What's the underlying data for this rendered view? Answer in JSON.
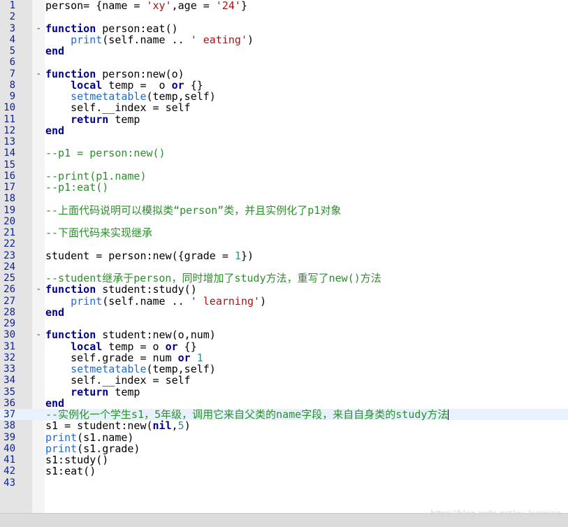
{
  "editor": {
    "colors": {
      "keyword": "#00008b",
      "string": "#a31515",
      "number": "#2f8f8f",
      "builtin": "#1a6bd8",
      "comment": "#2a8f2a",
      "line_number": "#10209a"
    },
    "current_line": 37,
    "lines": [
      {
        "n": "1",
        "fold": false,
        "tokens": [
          [
            "t",
            "person= {name = "
          ],
          [
            "s",
            "'xy'"
          ],
          [
            "t",
            ",age = "
          ],
          [
            "s",
            "'24'"
          ],
          [
            "t",
            "}"
          ]
        ]
      },
      {
        "n": "2",
        "fold": false,
        "tokens": []
      },
      {
        "n": "3",
        "fold": true,
        "tokens": [
          [
            "k",
            "function"
          ],
          [
            "t",
            " person:eat()"
          ]
        ]
      },
      {
        "n": "4",
        "fold": false,
        "tokens": [
          [
            "t",
            "    "
          ],
          [
            "f",
            "print"
          ],
          [
            "t",
            "(self.name .. "
          ],
          [
            "s",
            "' eating'"
          ],
          [
            "t",
            ")"
          ]
        ]
      },
      {
        "n": "5",
        "fold": false,
        "tokens": [
          [
            "k",
            "end"
          ]
        ]
      },
      {
        "n": "6",
        "fold": false,
        "tokens": []
      },
      {
        "n": "7",
        "fold": true,
        "tokens": [
          [
            "k",
            "function"
          ],
          [
            "t",
            " person:new(o)"
          ]
        ]
      },
      {
        "n": "8",
        "fold": false,
        "tokens": [
          [
            "t",
            "    "
          ],
          [
            "k",
            "local"
          ],
          [
            "t",
            " temp =  o "
          ],
          [
            "k",
            "or"
          ],
          [
            "t",
            " {}"
          ]
        ]
      },
      {
        "n": "9",
        "fold": false,
        "tokens": [
          [
            "t",
            "    "
          ],
          [
            "f",
            "setmetatable"
          ],
          [
            "t",
            "(temp,self)"
          ]
        ]
      },
      {
        "n": "10",
        "fold": false,
        "tokens": [
          [
            "t",
            "    self.__index = self"
          ]
        ]
      },
      {
        "n": "11",
        "fold": false,
        "tokens": [
          [
            "t",
            "    "
          ],
          [
            "k",
            "return"
          ],
          [
            "t",
            " temp"
          ]
        ]
      },
      {
        "n": "12",
        "fold": false,
        "tokens": [
          [
            "k",
            "end"
          ]
        ]
      },
      {
        "n": "13",
        "fold": false,
        "tokens": []
      },
      {
        "n": "14",
        "fold": false,
        "tokens": [
          [
            "c",
            "--p1 = person:new()"
          ]
        ]
      },
      {
        "n": "15",
        "fold": false,
        "tokens": []
      },
      {
        "n": "16",
        "fold": false,
        "tokens": [
          [
            "c",
            "--print(p1.name)"
          ]
        ]
      },
      {
        "n": "17",
        "fold": false,
        "tokens": [
          [
            "c",
            "--p1:eat()"
          ]
        ]
      },
      {
        "n": "18",
        "fold": false,
        "tokens": []
      },
      {
        "n": "19",
        "fold": false,
        "tokens": [
          [
            "c",
            "--上面代码说明可以模拟类“person”类，并且实例化了p1对象"
          ]
        ]
      },
      {
        "n": "20",
        "fold": false,
        "tokens": []
      },
      {
        "n": "21",
        "fold": false,
        "tokens": [
          [
            "c",
            "--下面代码来实现继承"
          ]
        ]
      },
      {
        "n": "22",
        "fold": false,
        "tokens": []
      },
      {
        "n": "23",
        "fold": false,
        "tokens": [
          [
            "t",
            "student = person:new({grade = "
          ],
          [
            "n",
            "1"
          ],
          [
            "t",
            "})"
          ]
        ]
      },
      {
        "n": "24",
        "fold": false,
        "tokens": []
      },
      {
        "n": "25",
        "fold": false,
        "tokens": [
          [
            "c",
            "--student继承于person，同时增加了study方法，重写了new()方法"
          ]
        ]
      },
      {
        "n": "26",
        "fold": true,
        "tokens": [
          [
            "k",
            "function"
          ],
          [
            "t",
            " student:study()"
          ]
        ]
      },
      {
        "n": "27",
        "fold": false,
        "tokens": [
          [
            "t",
            "    "
          ],
          [
            "f",
            "print"
          ],
          [
            "t",
            "(self.name .. "
          ],
          [
            "s",
            "' learning'"
          ],
          [
            "t",
            ")"
          ]
        ]
      },
      {
        "n": "28",
        "fold": false,
        "tokens": [
          [
            "k",
            "end"
          ]
        ]
      },
      {
        "n": "29",
        "fold": false,
        "tokens": []
      },
      {
        "n": "30",
        "fold": true,
        "tokens": [
          [
            "k",
            "function"
          ],
          [
            "t",
            " student:new(o,num)"
          ]
        ]
      },
      {
        "n": "31",
        "fold": false,
        "tokens": [
          [
            "t",
            "    "
          ],
          [
            "k",
            "local"
          ],
          [
            "t",
            " temp = o "
          ],
          [
            "k",
            "or"
          ],
          [
            "t",
            " {}"
          ]
        ]
      },
      {
        "n": "32",
        "fold": false,
        "tokens": [
          [
            "t",
            "    self.grade = num "
          ],
          [
            "k",
            "or"
          ],
          [
            "t",
            " "
          ],
          [
            "n",
            "1"
          ]
        ]
      },
      {
        "n": "33",
        "fold": false,
        "tokens": [
          [
            "t",
            "    "
          ],
          [
            "f",
            "setmetatable"
          ],
          [
            "t",
            "(temp,self)"
          ]
        ]
      },
      {
        "n": "34",
        "fold": false,
        "tokens": [
          [
            "t",
            "    self.__index = self"
          ]
        ]
      },
      {
        "n": "35",
        "fold": false,
        "tokens": [
          [
            "t",
            "    "
          ],
          [
            "k",
            "return"
          ],
          [
            "t",
            " temp"
          ]
        ]
      },
      {
        "n": "36",
        "fold": false,
        "tokens": [
          [
            "k",
            "end"
          ]
        ]
      },
      {
        "n": "37",
        "fold": false,
        "tokens": [
          [
            "c",
            "--实例化一个学生s1，5年级，调用它来自父类的name字段，来自自身类的study方法"
          ]
        ]
      },
      {
        "n": "38",
        "fold": false,
        "tokens": [
          [
            "t",
            "s1 = student:new("
          ],
          [
            "k",
            "nil"
          ],
          [
            "t",
            ","
          ],
          [
            "n",
            "5"
          ],
          [
            "t",
            ")"
          ]
        ]
      },
      {
        "n": "39",
        "fold": false,
        "tokens": [
          [
            "f",
            "print"
          ],
          [
            "t",
            "(s1.name)"
          ]
        ]
      },
      {
        "n": "40",
        "fold": false,
        "tokens": [
          [
            "f",
            "print"
          ],
          [
            "t",
            "(s1.grade)"
          ]
        ]
      },
      {
        "n": "41",
        "fold": false,
        "tokens": [
          [
            "t",
            "s1:study()"
          ]
        ]
      },
      {
        "n": "42",
        "fold": false,
        "tokens": [
          [
            "t",
            "s1:eat()"
          ]
        ]
      },
      {
        "n": "43",
        "fold": false,
        "tokens": []
      }
    ]
  },
  "watermark": "https://blog.csdn.net/xy_learning"
}
